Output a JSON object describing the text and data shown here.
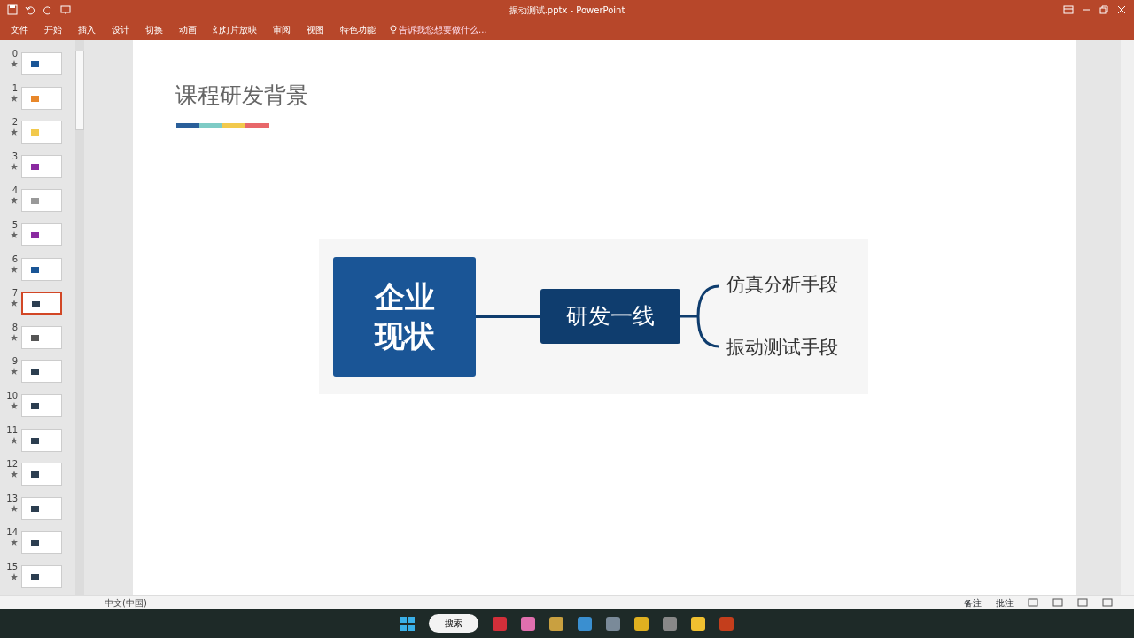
{
  "window": {
    "title": "振动测试.pptx - PowerPoint"
  },
  "ribbon_tabs": [
    {
      "label": "文件",
      "selected": false
    },
    {
      "label": "开始",
      "selected": false
    },
    {
      "label": "插入",
      "selected": false
    },
    {
      "label": "设计",
      "selected": false
    },
    {
      "label": "切换",
      "selected": false
    },
    {
      "label": "动画",
      "selected": false
    },
    {
      "label": "幻灯片放映",
      "selected": false
    },
    {
      "label": "审阅",
      "selected": false
    },
    {
      "label": "视图",
      "selected": false
    },
    {
      "label": "特色功能",
      "selected": false
    }
  ],
  "tell_me": {
    "placeholder": "告诉我您想要做什么..."
  },
  "slides": [
    {
      "number": "0",
      "selected": false
    },
    {
      "number": "1",
      "selected": false
    },
    {
      "number": "2",
      "selected": false
    },
    {
      "number": "3",
      "selected": false
    },
    {
      "number": "4",
      "selected": false
    },
    {
      "number": "5",
      "selected": false
    },
    {
      "number": "6",
      "selected": false
    },
    {
      "number": "7",
      "selected": true
    },
    {
      "number": "8",
      "selected": false
    },
    {
      "number": "9",
      "selected": false
    },
    {
      "number": "10",
      "selected": false
    },
    {
      "number": "11",
      "selected": false
    },
    {
      "number": "12",
      "selected": false
    },
    {
      "number": "13",
      "selected": false
    },
    {
      "number": "14",
      "selected": false
    },
    {
      "number": "15",
      "selected": false
    }
  ],
  "slide": {
    "title": "课程研发背景",
    "main_box": [
      "企业",
      "现状"
    ],
    "middle_box": "研发一线",
    "branches": [
      "仿真分析手段",
      "振动测试手段"
    ]
  },
  "status_bar": {
    "language": "中文(中国)",
    "notes": "备注",
    "comments": "批注"
  },
  "taskbar": {
    "search": "搜索"
  }
}
